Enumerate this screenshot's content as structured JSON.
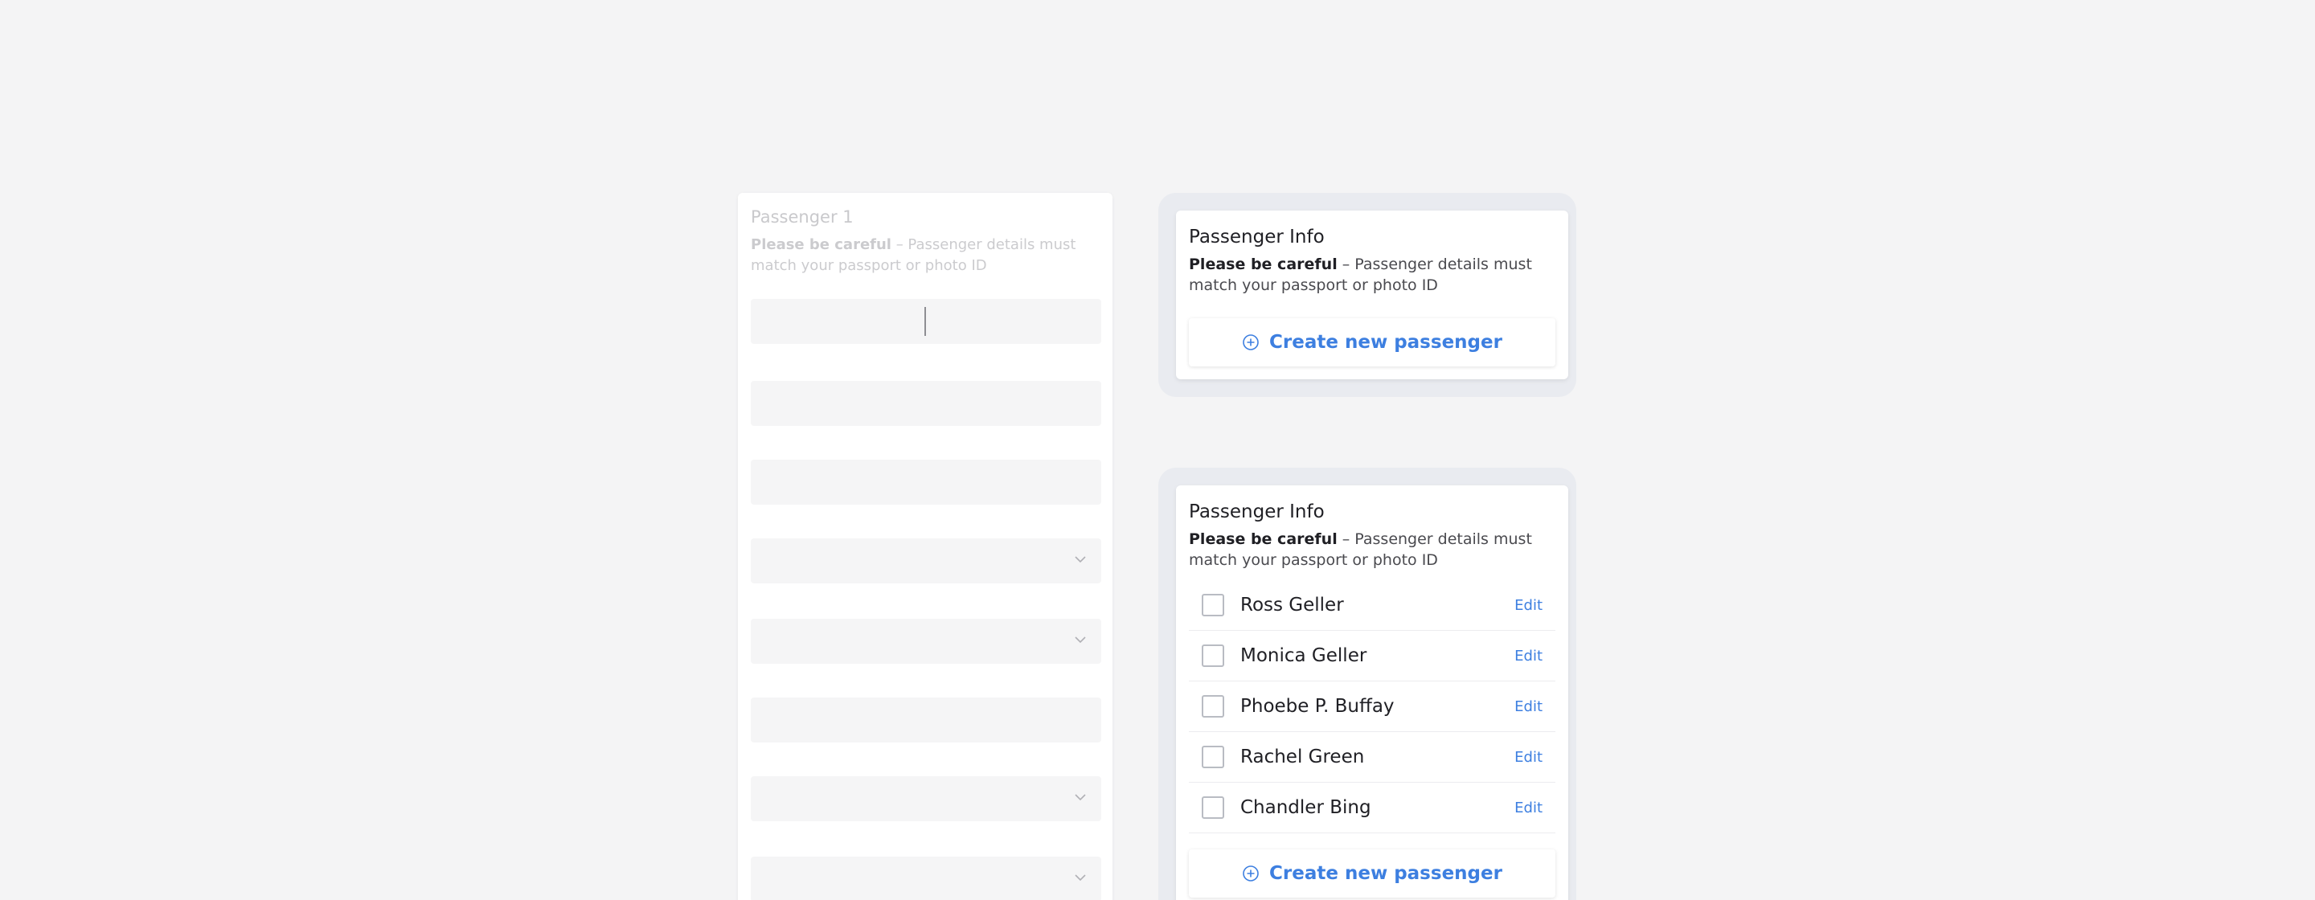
{
  "skeleton_form": {
    "title": "Passenger 1",
    "note_bold": "Please be careful",
    "note_text": " – Passenger details must match your passport or photo ID"
  },
  "panel_empty": {
    "title": "Passenger Info",
    "note_bold": "Please be careful",
    "note_text": " – Passenger details must match your passport or photo ID",
    "create_label": "Create new passenger"
  },
  "panel_list": {
    "title": "Passenger Info",
    "note_bold": "Please be careful",
    "note_text": " – Passenger details must match your passport or photo ID",
    "passengers": [
      {
        "name": "Ross Geller",
        "edit": "Edit"
      },
      {
        "name": "Monica Geller",
        "edit": "Edit"
      },
      {
        "name": "Phoebe P. Buffay",
        "edit": "Edit"
      },
      {
        "name": "Rachel Green",
        "edit": "Edit"
      },
      {
        "name": "Chandler Bing",
        "edit": "Edit"
      }
    ],
    "create_label": "Create new passenger"
  },
  "colors": {
    "accent": "#3d7fe0",
    "background": "#f4f4f5",
    "panel_frame": "#e9ebf0"
  }
}
